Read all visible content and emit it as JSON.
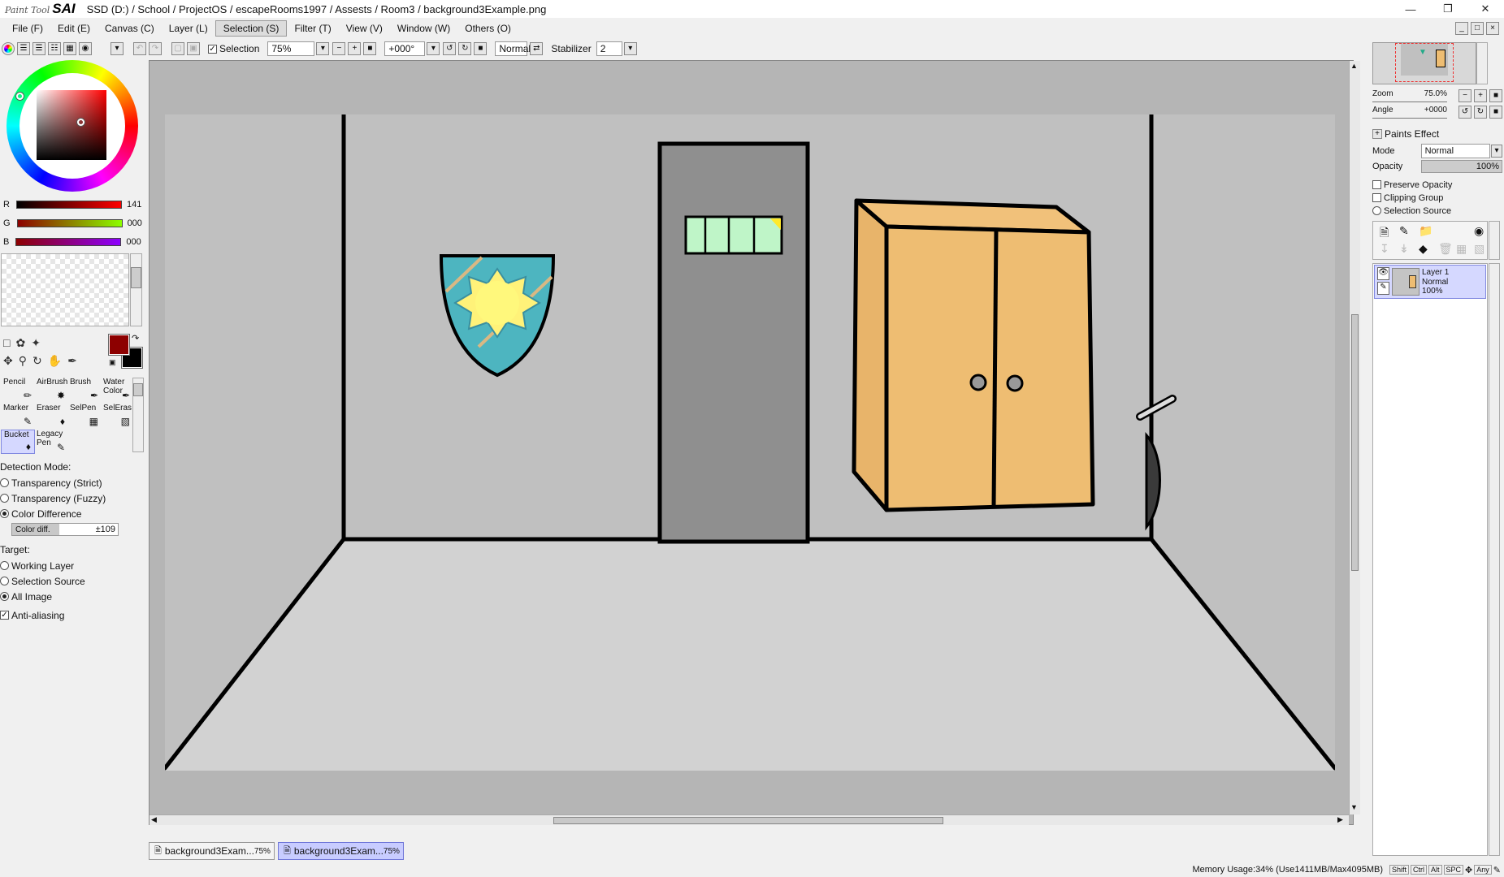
{
  "titlebar": {
    "app_logo_small": "Paint Tool",
    "app_logo_big": "SAI",
    "path": "SSD (D:) / School / ProjectOS / escapeRooms1997 / Assests / Room3 / background3Example.png"
  },
  "menu": [
    "File (F)",
    "Edit (E)",
    "Canvas (C)",
    "Layer (L)",
    "Selection (S)",
    "Filter (T)",
    "View (V)",
    "Window (W)",
    "Others (O)"
  ],
  "toolbar": {
    "selection_label": "Selection",
    "zoom": "75%",
    "angle": "+000°",
    "blend": "Normal",
    "stabilizer_label": "Stabilizer",
    "stabilizer_value": "2"
  },
  "color": {
    "r_label": "R",
    "r_value": "141",
    "g_label": "G",
    "g_value": "000",
    "b_label": "B",
    "b_value": "000",
    "primary": "#8d0000",
    "secondary": "#000000"
  },
  "tools": [
    {
      "label": "Pencil",
      "icon": "pencil-icon"
    },
    {
      "label": "AirBrush",
      "icon": "airbrush-icon"
    },
    {
      "label": "Brush",
      "icon": "brush-icon"
    },
    {
      "label": "Water Color",
      "icon": "watercolor-icon"
    },
    {
      "label": "Marker",
      "icon": "marker-icon"
    },
    {
      "label": "Eraser",
      "icon": "eraser-icon"
    },
    {
      "label": "SelPen",
      "icon": "selpen-icon"
    },
    {
      "label": "SelEras",
      "icon": "seleras-icon"
    },
    {
      "label": "Bucket",
      "icon": "bucket-icon"
    },
    {
      "label": "Legacy Pen",
      "icon": "legacy-pen-icon"
    }
  ],
  "bucket_options": {
    "detection_title": "Detection Mode:",
    "modes": [
      "Transparency (Strict)",
      "Transparency (Fuzzy)",
      "Color Difference"
    ],
    "selected_mode": 2,
    "colordiff_label": "Color diff.",
    "colordiff_value": "±109",
    "target_title": "Target:",
    "targets": [
      "Working Layer",
      "Selection Source",
      "All Image"
    ],
    "selected_target": 2,
    "antialias_label": "Anti-aliasing"
  },
  "navigator": {
    "zoom_label": "Zoom",
    "zoom_value": "75.0%",
    "angle_label": "Angle",
    "angle_value": "+0000"
  },
  "layer_props": {
    "paints_effect": "Paints Effect",
    "mode_label": "Mode",
    "mode_value": "Normal",
    "opacity_label": "Opacity",
    "opacity_value": "100%",
    "preserve_opacity": "Preserve Opacity",
    "clipping_group": "Clipping Group",
    "selection_source": "Selection Source"
  },
  "layers": [
    {
      "name": "Layer 1",
      "mode": "Normal",
      "opacity": "100%"
    }
  ],
  "tabs": [
    {
      "name": "background3Exam...",
      "zoom": "75%"
    },
    {
      "name": "background3Exam...",
      "zoom": "75%"
    }
  ],
  "status": {
    "memory": "Memory Usage:34% (Use1411MB/Max4095MB)",
    "keys": [
      "Shift",
      "Ctrl",
      "Alt",
      "SPC",
      "Any"
    ]
  }
}
